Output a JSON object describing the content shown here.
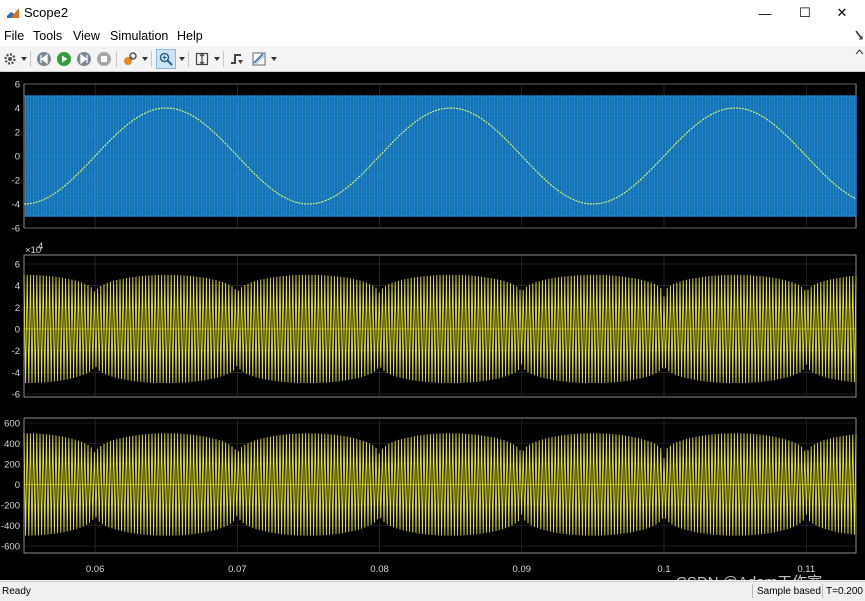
{
  "window": {
    "title": "Scope2",
    "minimize_glyph": "—",
    "maximize_glyph": "☐",
    "close_glyph": "✕"
  },
  "menu": [
    "File",
    "Tools",
    "View",
    "Simulation",
    "Help"
  ],
  "toolbar": {
    "icons": [
      "settings-icon",
      "step-back-icon",
      "run-icon",
      "step-forward-icon",
      "stop-icon",
      "highlight-icon",
      "zoom-icon",
      "scale-axes-icon",
      "triggers-icon",
      "measurements-icon"
    ]
  },
  "status": {
    "left": "Ready",
    "mode": "Sample based",
    "time": "T=0.200"
  },
  "watermark": "CSDN @Adam工作室",
  "colors": {
    "plot_bg": "#000000",
    "axes": "#b0b0b0",
    "grid": "#3a3a3a",
    "blue": "#1e8ad6",
    "yellow": "#e6e61a",
    "sine": "#e0ff66"
  },
  "chart_data": [
    {
      "type": "line",
      "x_range": [
        0.055,
        0.1135
      ],
      "ylim": [
        -6,
        6
      ],
      "yticks": [
        "6",
        "4",
        "2",
        "0",
        "-2",
        "-4",
        "-6"
      ],
      "series": [
        {
          "kind": "pwm-square",
          "amplitude": 5,
          "color": "#1e8ad6"
        },
        {
          "kind": "sine",
          "amplitude": 4,
          "frequency_hz": 50,
          "peak_times": [
            0.065,
            0.085,
            0.105
          ],
          "color": "#e0ff66"
        }
      ]
    },
    {
      "type": "line",
      "x_range": [
        0.055,
        0.1135
      ],
      "ylim": [
        -6,
        6
      ],
      "y_multiplier": "×10",
      "y_exponent": "4",
      "yticks": [
        "6",
        "4",
        "2",
        "0",
        "-2",
        "-4",
        "-6"
      ],
      "series": [
        {
          "kind": "modulated-oscillation",
          "envelope_max": 5,
          "envelope_min": 3,
          "color": "#e6e61a"
        }
      ]
    },
    {
      "type": "line",
      "x_range": [
        0.055,
        0.1135
      ],
      "ylim": [
        -600,
        600
      ],
      "yticks": [
        "600",
        "400",
        "200",
        "0",
        "-200",
        "-400",
        "-600"
      ],
      "xticks": [
        "0.06",
        "0.07",
        "0.08",
        "0.09",
        "0.1",
        "0.11"
      ],
      "xtick_values": [
        0.06,
        0.07,
        0.08,
        0.09,
        0.1,
        0.11
      ],
      "series": [
        {
          "kind": "modulated-oscillation",
          "envelope_max": 500,
          "envelope_min": 260,
          "color": "#e6e61a"
        }
      ]
    }
  ]
}
